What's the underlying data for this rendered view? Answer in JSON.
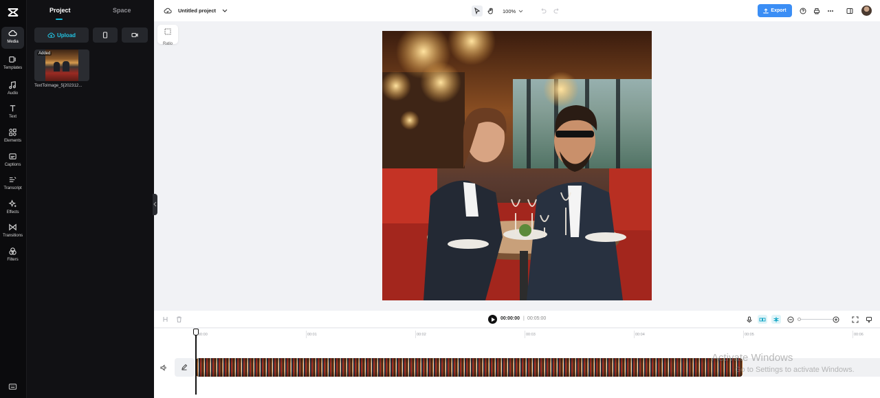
{
  "rail": {
    "items": [
      {
        "label": "Media"
      },
      {
        "label": "Templates"
      },
      {
        "label": "Audio"
      },
      {
        "label": "Text"
      },
      {
        "label": "Elements"
      },
      {
        "label": "Captions"
      },
      {
        "label": "Transcript"
      },
      {
        "label": "Effects"
      },
      {
        "label": "Transitions"
      },
      {
        "label": "Filters"
      }
    ]
  },
  "panel": {
    "tabs": [
      "Project",
      "Space"
    ],
    "upload_label": "Upload",
    "media": {
      "badge": "Added",
      "filename": "TextToImage_5[202312..."
    }
  },
  "topbar": {
    "project_title": "Untitled project",
    "zoom": "100%",
    "export_label": "Export"
  },
  "canvas": {
    "ratio_label": "Ratio"
  },
  "playbar": {
    "current_time": "00:00:00",
    "separator": "|",
    "total_time": "00:05:00"
  },
  "timeline": {
    "ticks": [
      "00:00",
      "00:01",
      "00:02",
      "00:03",
      "00:04",
      "00:05",
      "00:06"
    ]
  },
  "watermark": {
    "title": "Activate Windows",
    "subtitle": "Go to Settings to activate Windows."
  }
}
